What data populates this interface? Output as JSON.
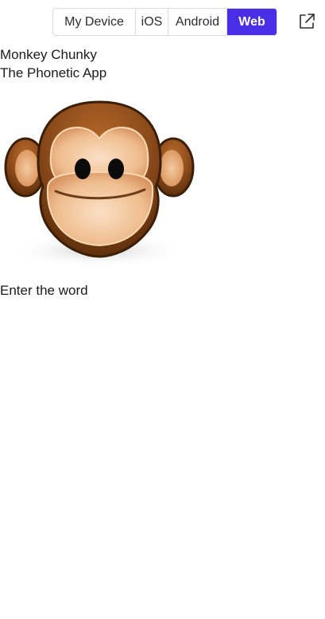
{
  "platform_switcher": {
    "options": [
      "My Device",
      "iOS",
      "Android",
      "Web"
    ],
    "selected": "Web"
  },
  "toolbar": {
    "open_external_icon": "open-external-icon"
  },
  "app": {
    "title_line1": "Monkey Chunky",
    "title_line2": "The Phonetic App",
    "logo_icon": "monkey-face",
    "prompt": "Enter the word"
  },
  "colors": {
    "accent": "#4a2de6",
    "monkey_fur": "#8b4a1a",
    "monkey_face": "#f2c9a0"
  }
}
